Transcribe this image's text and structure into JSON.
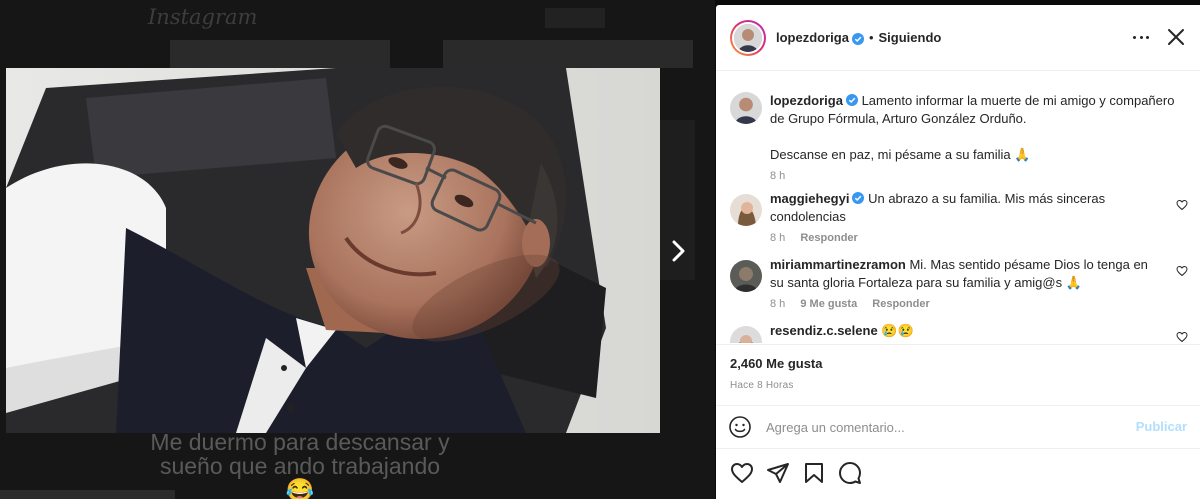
{
  "background": {
    "logo": "Instagram",
    "caption": "Me duermo para descansar y sueño que ando trabajando😂"
  },
  "post": {
    "header": {
      "username": "lopezdoriga",
      "separator": "•",
      "follow_status": "Siguiendo"
    },
    "caption": {
      "username": "lopezdoriga",
      "text": "Lamento informar la muerte de mi amigo y compañero de Grupo Fórmula, Arturo González Orduño.",
      "text2": "Descanse en paz, mi pésame a su familia 🙏",
      "time": "8 h"
    },
    "comments": [
      {
        "username": "maggiehegyi",
        "text": "Un abrazo a su familia. Mis más sinceras condolencias",
        "time": "8 h",
        "reply_label": "Responder"
      },
      {
        "username": "miriammartinezramon",
        "text": "Mi. Mas sentido pésame Dios lo tenga en su santa gloria Fortaleza para su familia y amig@s 🙏",
        "time": "8 h",
        "likes": "9 Me gusta",
        "reply_label": "Responder"
      },
      {
        "username": "resendiz.c.selene",
        "text": "😢😢"
      }
    ],
    "likes": "2,460 Me gusta",
    "timestamp": "Hace 8 Horas",
    "comment_placeholder": "Agrega un comentario...",
    "publish_label": "Publicar"
  },
  "colors": {
    "verified": "#3897f0",
    "link_disabled": "#b2dffc",
    "muted": "#8e8e8e",
    "text": "#262626"
  },
  "icons": [
    "next-arrow-icon",
    "more-options-icon",
    "close-icon",
    "verified-badge-icon",
    "heart-icon",
    "emoji-icon",
    "comment-icon",
    "share-icon",
    "bookmark-icon"
  ]
}
